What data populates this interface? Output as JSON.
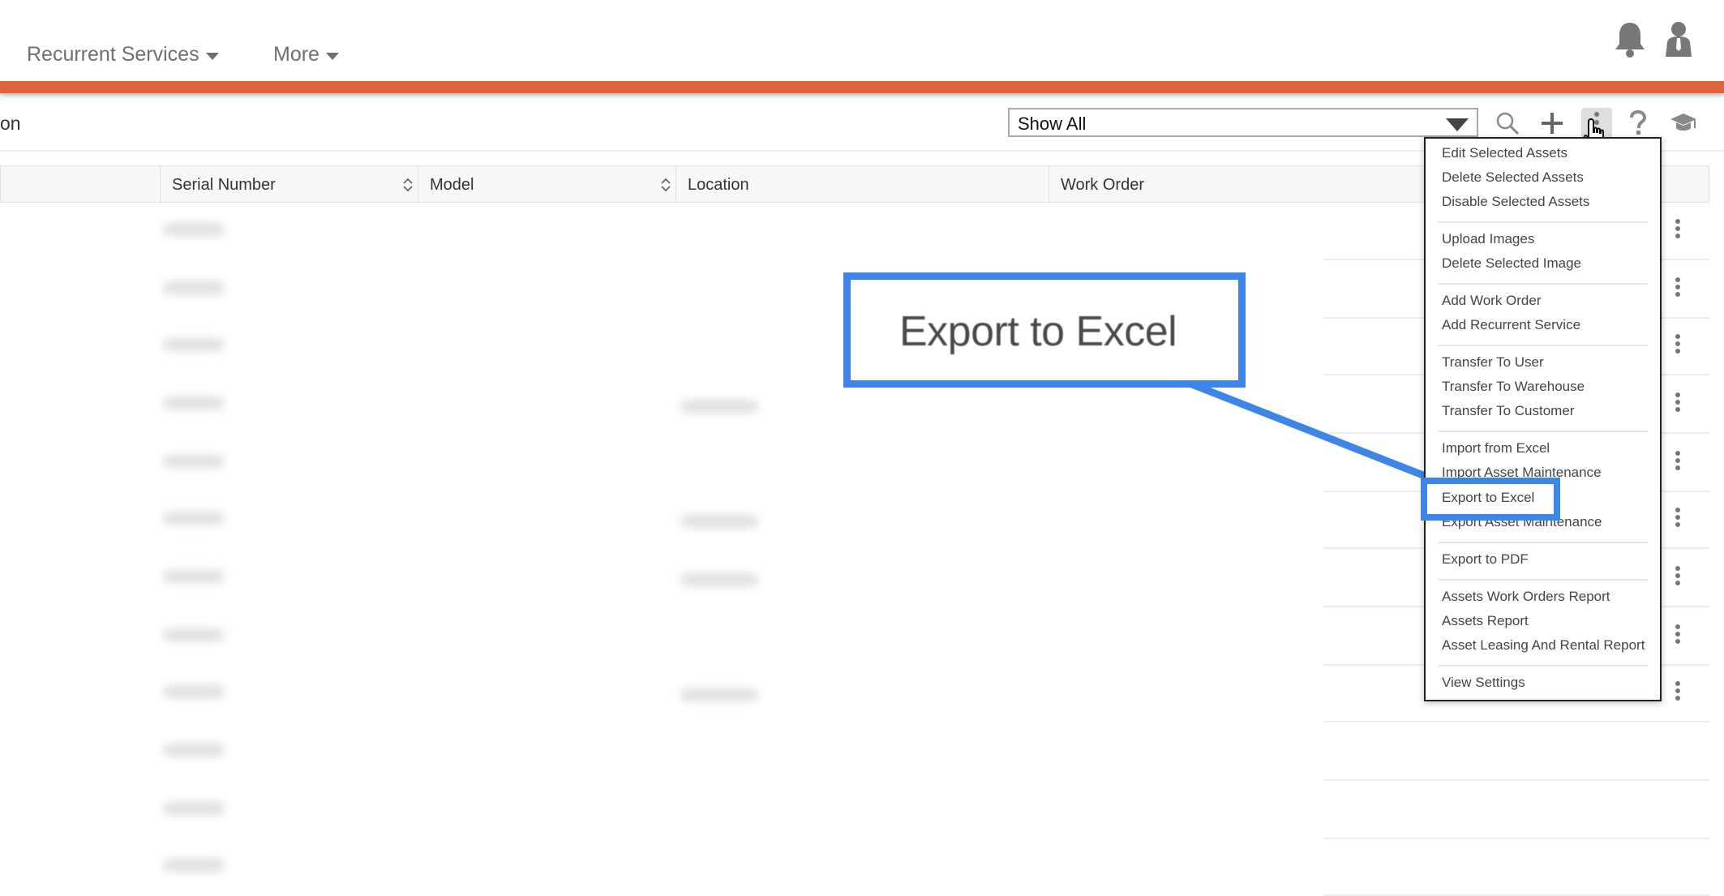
{
  "nav": {
    "items": [
      {
        "label": "Recurrent Services"
      },
      {
        "label": "More"
      }
    ]
  },
  "toolbar": {
    "partial_label": "on",
    "filter": {
      "selected": "Show All"
    }
  },
  "table": {
    "columns": [
      "Serial Number",
      "Model",
      "Location",
      "Work Order"
    ]
  },
  "menu": {
    "items": [
      "Edit Selected Assets",
      "Delete Selected Assets",
      "Disable Selected Assets",
      "Upload Images",
      "Delete Selected Image",
      "Add Work Order",
      "Add Recurrent Service",
      "Transfer To User",
      "Transfer To Warehouse",
      "Transfer To Customer",
      "Import from Excel",
      "Import Asset Maintenance",
      "Export to Excel",
      "Export Asset Maintenance",
      "Export to PDF",
      "Assets Work Orders Report",
      "Assets Report",
      "Asset Leasing And Rental Report",
      "View Settings"
    ]
  },
  "callout": {
    "text": "Export to Excel"
  },
  "colors": {
    "accent_orange": "#e0633a",
    "highlight_blue": "#3d86e8"
  },
  "icons": [
    "bell-icon",
    "user-icon",
    "search-icon",
    "plus-icon",
    "more-vertical-icon",
    "help-icon",
    "graduation-cap-icon",
    "hand-cursor-icon",
    "kebab-icon"
  ]
}
